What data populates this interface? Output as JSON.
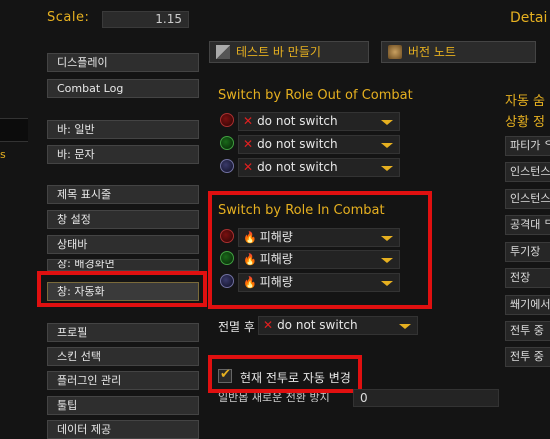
{
  "header": {
    "scale_label": "Scale:",
    "scale_value": "1.15",
    "detail_label": "Detai"
  },
  "sidebar": {
    "items": [
      {
        "label": "디스플레이"
      },
      {
        "label": "Combat Log"
      },
      {
        "label": "바: 일반"
      },
      {
        "label": "바: 문자"
      },
      {
        "label": "제목 표시줄"
      },
      {
        "label": "창 설정"
      },
      {
        "label": "상태바"
      },
      {
        "label": "창: 배경화면"
      },
      {
        "label": "창: 자동화",
        "selected": true
      },
      {
        "label": "프로필"
      },
      {
        "label": "스킨 선택"
      },
      {
        "label": "플러그인 관리"
      },
      {
        "label": "툴팁"
      },
      {
        "label": "데이터 제공"
      }
    ],
    "left_edge_text": "s"
  },
  "toolbar": {
    "test_bar_label": "테스트 바 만들기",
    "version_notes_label": "버전 노트"
  },
  "out_of_combat": {
    "title": "Switch by Role Out of Combat",
    "rows": [
      {
        "role_icon": "dps-icon",
        "value": "do not switch"
      },
      {
        "role_icon": "healer-icon",
        "value": "do not switch"
      },
      {
        "role_icon": "tank-icon",
        "value": "do not switch"
      }
    ]
  },
  "in_combat": {
    "title": "Switch by Role In Combat",
    "rows": [
      {
        "role_icon": "dps-icon",
        "value": "피해량"
      },
      {
        "role_icon": "healer-icon",
        "value": "피해량"
      },
      {
        "role_icon": "tank-icon",
        "value": "피해량"
      }
    ]
  },
  "after_combat": {
    "label": "전멸 후",
    "value": "do not switch"
  },
  "auto_change": {
    "label": "현재 전투로 자동 변경",
    "checked": true
  },
  "cut_option": {
    "label": "일반몹 새로운 전환 방지",
    "value": "0"
  },
  "right_panel": {
    "heading1": "자동 숨",
    "heading2": "상황 정",
    "items": [
      "파티가 ᄋ",
      "인스턴스",
      "인스턴스",
      "공격대 ᄃ",
      "투기장",
      "전장",
      "쐐기에서",
      "전투 중",
      "전투 중"
    ]
  },
  "colors": {
    "accent": "#e6b020",
    "highlight_border": "#e01010",
    "background": "#141414"
  }
}
